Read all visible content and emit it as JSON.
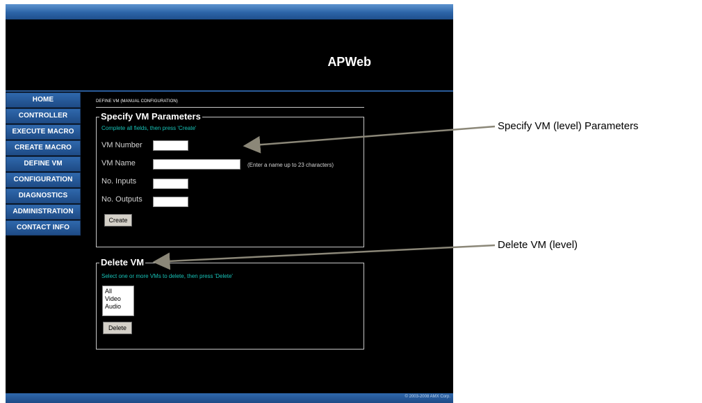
{
  "app": {
    "brand": "APWeb",
    "copyright": "© 2003-2008 AMX Corp."
  },
  "sidebar": {
    "items": [
      {
        "label": "HOME"
      },
      {
        "label": "CONTROLLER"
      },
      {
        "label": "EXECUTE MACRO"
      },
      {
        "label": "CREATE MACRO"
      },
      {
        "label": "DEFINE VM"
      },
      {
        "label": "CONFIGURATION"
      },
      {
        "label": "DIAGNOSTICS"
      },
      {
        "label": "ADMINISTRATION"
      },
      {
        "label": "CONTACT INFO"
      }
    ]
  },
  "content": {
    "title": "DEFINE VM (MANUAL CONFIGURATION)",
    "specify": {
      "legend": "Specify VM Parameters",
      "hint": "Complete all fields, then press 'Create'",
      "fields": {
        "vm_number": {
          "label": "VM Number",
          "value": ""
        },
        "vm_name": {
          "label": "VM Name",
          "value": "",
          "help": "(Enter a name up to 23 characters)"
        },
        "no_inputs": {
          "label": "No. Inputs",
          "value": ""
        },
        "no_outputs": {
          "label": "No. Outputs",
          "value": ""
        }
      },
      "create_label": "Create"
    },
    "delete": {
      "legend": "Delete VM",
      "hint": "Select one or more VMs to delete, then press 'Delete'",
      "options": [
        "All",
        "Video",
        "Audio"
      ],
      "delete_label": "Delete"
    }
  },
  "annotations": {
    "specify_callout": "Specify VM (level) Parameters",
    "delete_callout": "Delete VM (level)",
    "line_color": "#8b8778"
  }
}
